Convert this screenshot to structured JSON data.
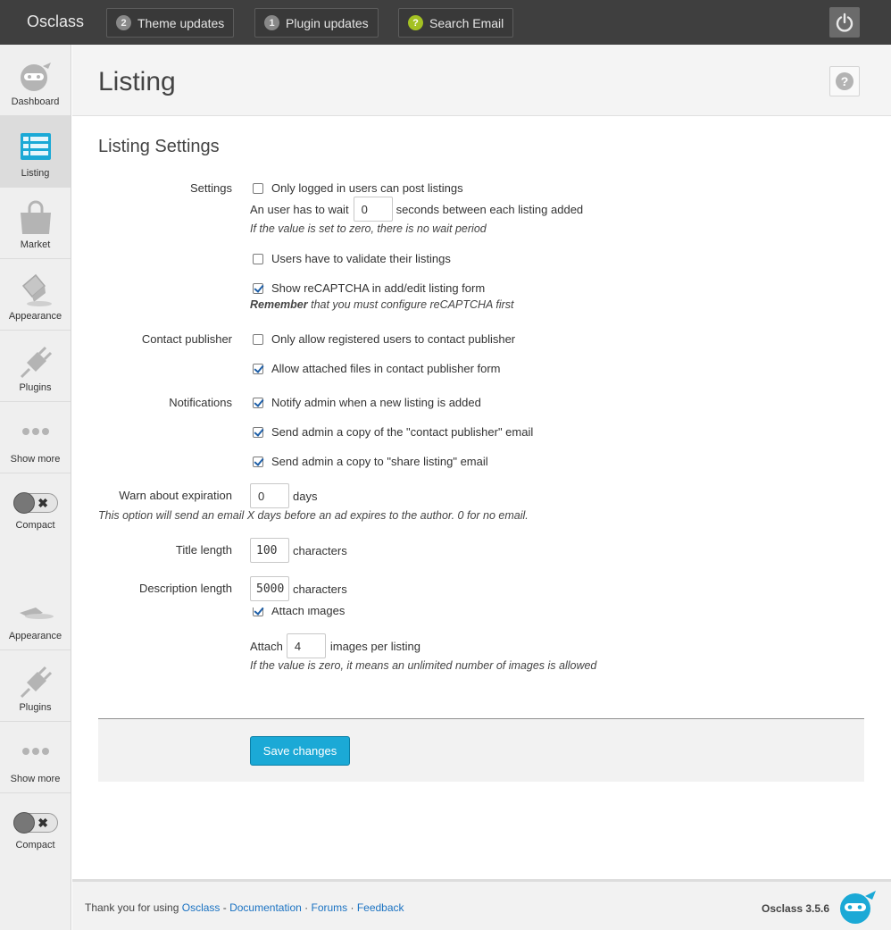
{
  "topbar": {
    "brand": "Osclass",
    "theme_updates": {
      "count": "2",
      "label": "Theme updates"
    },
    "plugin_updates": {
      "count": "1",
      "label": "Plugin updates"
    },
    "search_email": {
      "badge": "?",
      "label": "Search Email"
    }
  },
  "sidebar": {
    "items": [
      {
        "label": "Dashboard",
        "icon": "dashboard-icon"
      },
      {
        "label": "Listing",
        "icon": "listing-icon"
      },
      {
        "label": "Market",
        "icon": "market-icon"
      },
      {
        "label": "Appearance",
        "icon": "appearance-icon"
      },
      {
        "label": "Plugins",
        "icon": "plugins-icon"
      },
      {
        "label": "Show more",
        "icon": "show-more-icon"
      },
      {
        "label": "Compact",
        "icon": "compact-toggle-icon"
      }
    ],
    "duplicate_items": [
      {
        "label": "Appearance"
      },
      {
        "label": "Plugins"
      },
      {
        "label": "Show more"
      },
      {
        "label": "Compact"
      }
    ]
  },
  "header": {
    "title": "Listing"
  },
  "main": {
    "section_title": "Listing Settings",
    "settings": {
      "label": "Settings",
      "only_logged_in": {
        "label": "Only logged in users can post listings",
        "checked": false
      },
      "wait_prefix": "An user has to wait",
      "wait_value": "0",
      "wait_suffix": "seconds between each listing added",
      "wait_hint": "If the value is set to zero, there is no wait period",
      "validate": {
        "label": "Users have to validate their listings",
        "checked": false
      },
      "recaptcha": {
        "label": "Show reCAPTCHA in add/edit listing form",
        "checked": true
      },
      "recaptcha_hint_bold": "Remember",
      "recaptcha_hint_rest": " that you must configure reCAPTCHA first"
    },
    "contact": {
      "label": "Contact publisher",
      "only_registered": {
        "label": "Only allow registered users to contact publisher",
        "checked": false
      },
      "attached_files": {
        "label": "Allow attached files in contact publisher form",
        "checked": true
      }
    },
    "notifications": {
      "label": "Notifications",
      "notify_admin": {
        "label": "Notify admin when a new listing is added",
        "checked": true
      },
      "copy_contact": {
        "label": "Send admin a copy of the \"contact publisher\" email",
        "checked": true
      },
      "copy_share": {
        "label": "Send admin a copy to \"share listing\" email",
        "checked": true
      }
    },
    "expiration": {
      "label": "Warn about expiration",
      "value": "0",
      "unit": "days",
      "hint": "This option will send an email X days before an ad expires to the author. 0 for no email."
    },
    "title_length": {
      "label": "Title length",
      "value": "100",
      "unit": "characters"
    },
    "description_length": {
      "label": "Description length",
      "value": "5000",
      "unit": "characters"
    },
    "attach_images": {
      "label": "Attach images",
      "checked": true
    },
    "images_per_listing": {
      "prefix": "Attach",
      "value": "4",
      "suffix": "images per listing",
      "hint": "If the value is zero, it means an unlimited number of images is allowed"
    },
    "save_label": "Save changes"
  },
  "footer": {
    "thanks": "Thank you for using ",
    "link_osclass": "Osclass",
    "sep1": " - ",
    "link_docs": "Documentation",
    "sep2": " · ",
    "link_forums": "Forums",
    "sep3": " · ",
    "link_feedback": "Feedback",
    "version": "Osclass 3.5.6"
  },
  "colors": {
    "accent": "#1ba9d6",
    "topbar": "#3f3f3f",
    "link": "#1a72c2",
    "badge_green": "#a4c123"
  }
}
